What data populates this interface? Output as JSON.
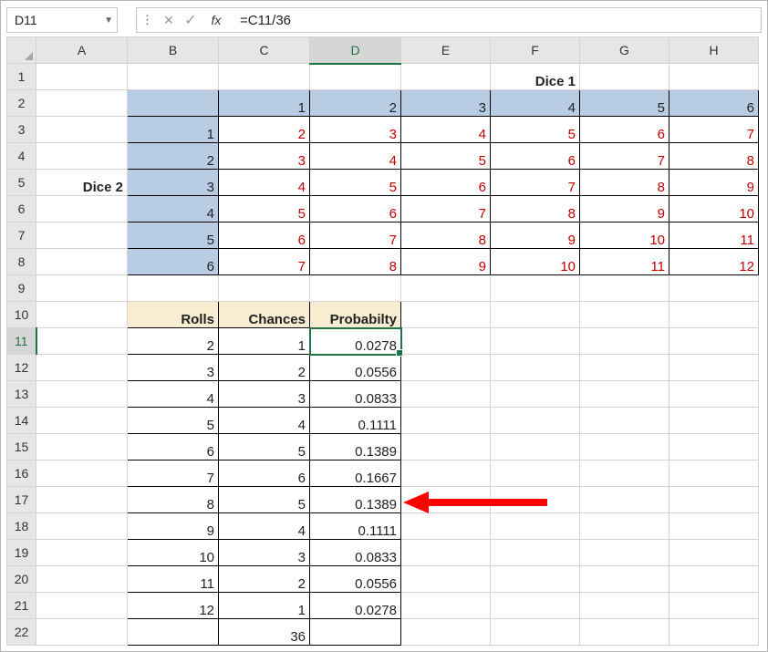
{
  "formula_bar": {
    "name_box": "D11",
    "fx_label": "fx",
    "formula": "=C11/36"
  },
  "columns": [
    "A",
    "B",
    "C",
    "D",
    "E",
    "F",
    "G",
    "H"
  ],
  "rows": [
    "1",
    "2",
    "3",
    "4",
    "5",
    "6",
    "7",
    "8",
    "9",
    "10",
    "11",
    "12",
    "13",
    "14",
    "15",
    "16",
    "17",
    "18",
    "19",
    "20",
    "21",
    "22"
  ],
  "labels": {
    "dice1": "Dice 1",
    "dice2": "Dice 2",
    "rolls": "Rolls",
    "chances": "Chances",
    "probability": "Probabilty"
  },
  "dice1_headers": [
    "1",
    "2",
    "3",
    "4",
    "5",
    "6"
  ],
  "dice2_headers": [
    "1",
    "2",
    "3",
    "4",
    "5",
    "6"
  ],
  "dice_table": [
    [
      "2",
      "3",
      "4",
      "5",
      "6",
      "7"
    ],
    [
      "3",
      "4",
      "5",
      "6",
      "7",
      "8"
    ],
    [
      "4",
      "5",
      "6",
      "7",
      "8",
      "9"
    ],
    [
      "5",
      "6",
      "7",
      "8",
      "9",
      "10"
    ],
    [
      "6",
      "7",
      "8",
      "9",
      "10",
      "11"
    ],
    [
      "7",
      "8",
      "9",
      "10",
      "11",
      "12"
    ]
  ],
  "prob_table": [
    {
      "roll": "2",
      "chances": "1",
      "probability": "0.0278"
    },
    {
      "roll": "3",
      "chances": "2",
      "probability": "0.0556"
    },
    {
      "roll": "4",
      "chances": "3",
      "probability": "0.0833"
    },
    {
      "roll": "5",
      "chances": "4",
      "probability": "0.1111"
    },
    {
      "roll": "6",
      "chances": "5",
      "probability": "0.1389"
    },
    {
      "roll": "7",
      "chances": "6",
      "probability": "0.1667"
    },
    {
      "roll": "8",
      "chances": "5",
      "probability": "0.1389"
    },
    {
      "roll": "9",
      "chances": "4",
      "probability": "0.1111"
    },
    {
      "roll": "10",
      "chances": "3",
      "probability": "0.0833"
    },
    {
      "roll": "11",
      "chances": "2",
      "probability": "0.0556"
    },
    {
      "roll": "12",
      "chances": "1",
      "probability": "0.0278"
    }
  ],
  "chances_total": "36"
}
